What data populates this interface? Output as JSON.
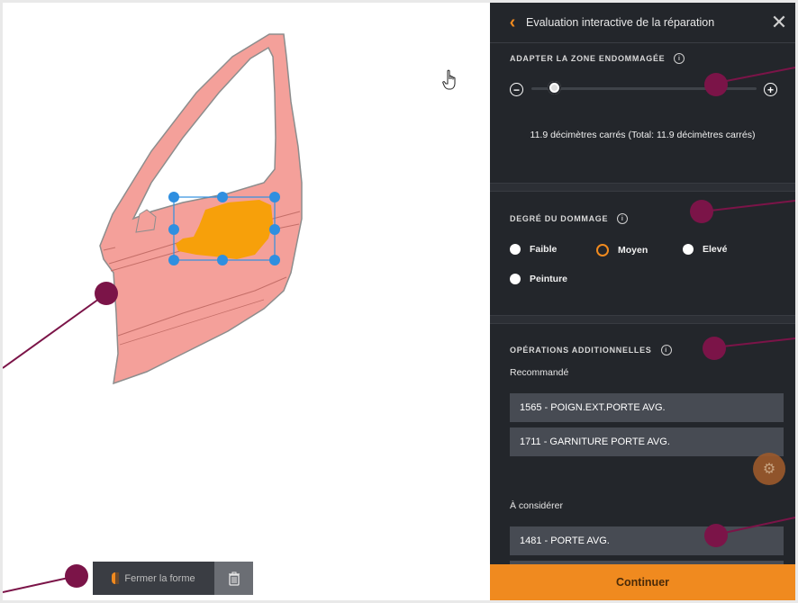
{
  "panel": {
    "title": "Evaluation interactive de la réparation",
    "back_icon": "chevron-left-icon",
    "close_icon": "close-icon"
  },
  "zone": {
    "label": "ADAPTER LA ZONE ENDOMMAGÉE",
    "info": "i",
    "minus": "−",
    "plus": "+",
    "slider_fraction": 0.1,
    "area_text": "11.9 décimètres carrés (Total: 11.9 décimètres carrés)"
  },
  "damage": {
    "label": "DEGRÉ DU DOMMAGE",
    "info": "i",
    "options": [
      "Faible",
      "Moyen",
      "Elevé",
      "Peinture"
    ],
    "selected": "Moyen"
  },
  "operations": {
    "label": "OPÉRATIONS ADDITIONNELLES",
    "info": "i",
    "recommended_label": "Recommandé",
    "recommended": [
      "1565 - POIGN.EXT.PORTE AVG.",
      "1711 - GARNITURE PORTE AVG."
    ],
    "consider_label": "À considérer",
    "consider": [
      "1481 - PORTE AVG."
    ]
  },
  "continue_label": "Continuer",
  "toolbar": {
    "close_shape_label": "Fermer la forme",
    "trash_icon": "trash-icon"
  },
  "colors": {
    "accent": "#f08a1f",
    "panel_bg": "#23262b",
    "door_fill": "#f4a09a",
    "damage_fill": "#f7a00a",
    "handle_blue": "#2f8fe0",
    "annotation": "#7b1448"
  }
}
